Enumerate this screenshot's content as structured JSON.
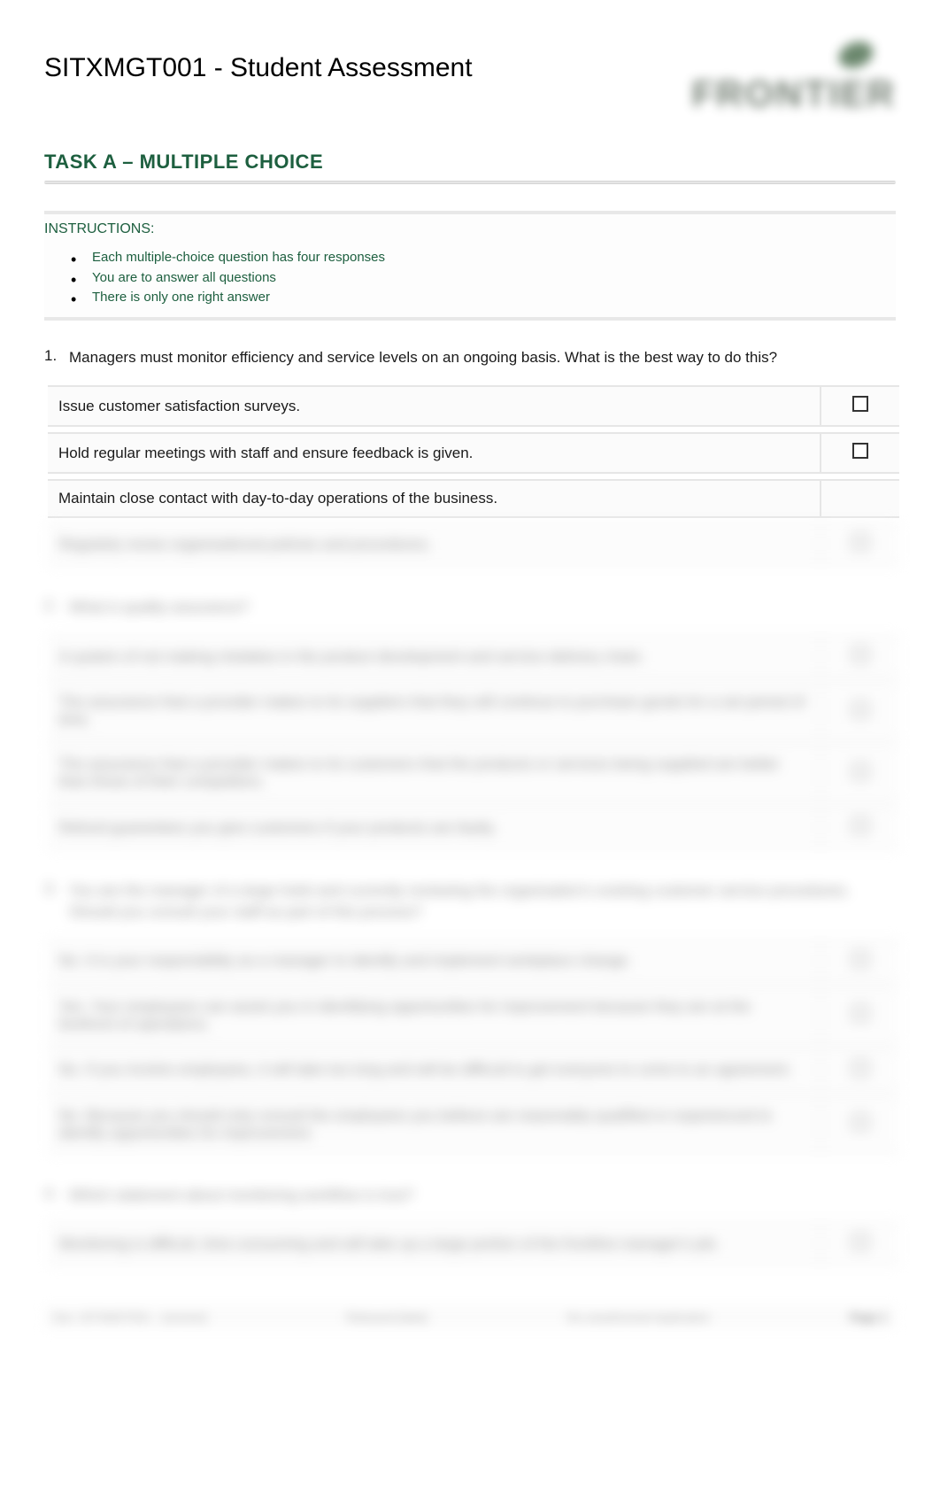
{
  "header": {
    "title": "SITXMGT001 - Student Assessment",
    "logo_text": "FRONTIER"
  },
  "task": {
    "title": "TASK A – MULTIPLE CHOICE"
  },
  "instructions": {
    "title": "INSTRUCTIONS:",
    "items": [
      "Each multiple-choice question has four responses",
      "You are to answer all questions",
      "There is only one right answer"
    ]
  },
  "questions": [
    {
      "num": "1.",
      "text": "Managers must monitor efficiency and service levels on an ongoing basis. What is the best way to do this?",
      "answers": [
        {
          "text": "Issue customer satisfaction surveys.",
          "checkbox": true
        },
        {
          "text": "Hold regular meetings with staff and ensure feedback is given.",
          "checkbox": true
        },
        {
          "text": "Maintain close contact with day-to-day operations of the business.",
          "checkbox": false
        },
        {
          "text": "Regularly revise organisational policies and procedures.",
          "checkbox": true
        }
      ]
    },
    {
      "num": "2.",
      "text": "What is quality assurance?",
      "answers": [
        {
          "text": "A system of not making mistakes in the product development and service delivery chain.",
          "checkbox": true
        },
        {
          "text": "The assurance that a provider makes to its suppliers that they will continue to purchase goods for a set period of time.",
          "checkbox": true
        },
        {
          "text": "The assurance that a provider makes to its customers that the products or services being supplied are better than those of their competitors.",
          "checkbox": true
        },
        {
          "text": "Refund guarantees you give customers if your products are faulty.",
          "checkbox": true
        }
      ]
    },
    {
      "num": "3.",
      "text": "You are the manager of a large hotel and currently reviewing the organisation's existing customer service procedures. Should you consult your staff as part of this process?",
      "answers": [
        {
          "text": "No. It is your responsibility as a manager to identify and implement workplace change.",
          "checkbox": true
        },
        {
          "text": "Yes. Your employees can assist you in identifying opportunities for improvement because they are at the forefront of operations.",
          "checkbox": true
        },
        {
          "text": "No. If you involve employees, it will take too long and will be difficult to get everyone to come to an agreement.",
          "checkbox": true
        },
        {
          "text": "No. Because you should only consult the employees you believe are reasonably qualified or experienced to identify opportunities for improvement.",
          "checkbox": true
        }
      ]
    },
    {
      "num": "4.",
      "text": "Which statement about monitoring workflow is true?",
      "answers": [
        {
          "text": "Monitoring is difficult, time-consuming and will take up a large portion of the frontline manager's job.",
          "checkbox": true
        }
      ]
    }
  ],
  "footer": {
    "left": "Doc: SITXMGT001 – [version]",
    "mid": "Released [date]",
    "right": "No unauthorised duplication",
    "page": "Page 1"
  }
}
